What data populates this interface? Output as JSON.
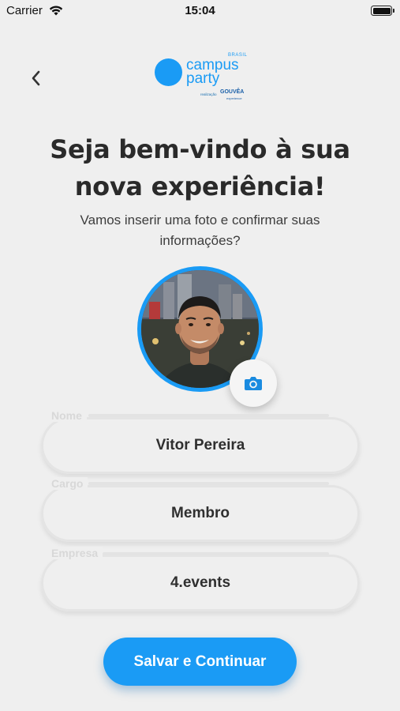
{
  "status_bar": {
    "carrier": "Carrier",
    "time": "15:04"
  },
  "logo": {
    "line1": "campus",
    "line2": "party",
    "country": "BRASIL",
    "realization": "realização",
    "partner": "GOUVÊA",
    "partner_sub": "experience"
  },
  "header": {
    "title_line1": "Seja bem-vindo à sua",
    "title_line2": "nova experiência!",
    "subtitle_line1": "Vamos inserir uma foto e confirmar suas",
    "subtitle_line2": "informações?"
  },
  "form": {
    "name_label": "Nome",
    "name_value": "Vitor Pereira",
    "role_label": "Cargo",
    "role_value": "Membro",
    "company_label": "Empresa",
    "company_value": "4.events"
  },
  "actions": {
    "save_label": "Salvar e Continuar"
  },
  "colors": {
    "accent": "#1a9bf5",
    "background": "#efefef",
    "text": "#2b2b2b"
  },
  "icons": {
    "back": "chevron-left-icon",
    "camera": "camera-icon",
    "wifi": "wifi-icon",
    "battery": "battery-icon"
  }
}
